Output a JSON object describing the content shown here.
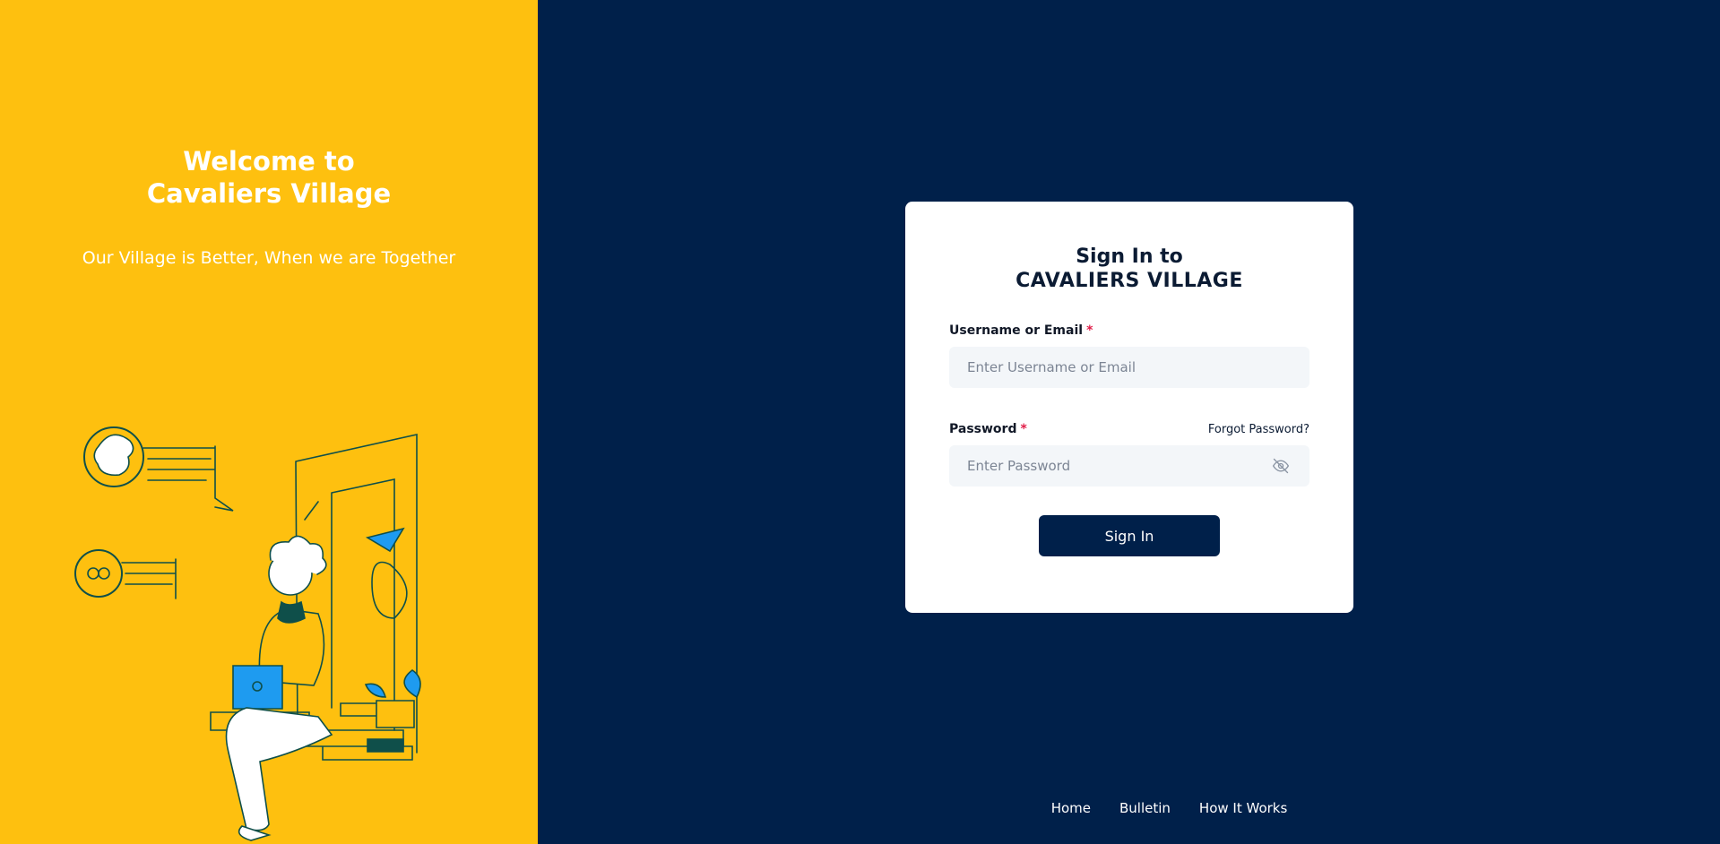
{
  "welcome": {
    "line1": "Welcome to",
    "line2": "Cavaliers Village",
    "tagline": "Our Village is Better, When we are Together"
  },
  "illustration": {
    "icon": "person-working-laptop-illustration"
  },
  "card": {
    "title_line1": "Sign In to",
    "title_line2": "CAVALIERS VILLAGE",
    "username_label": "Username or Email",
    "username_placeholder": "Enter Username or Email",
    "username_value": "",
    "password_label": "Password",
    "password_placeholder": "Enter Password",
    "password_value": "",
    "forgot_password": "Forgot Password?",
    "required_mark": "*",
    "submit_label": "Sign In"
  },
  "footer": {
    "links": [
      "Home",
      "Bulletin",
      "How It Works"
    ]
  },
  "colors": {
    "left_bg": "#FEC00F",
    "right_bg": "#00204A",
    "accent_blue": "#1E9BF0",
    "required": "#e11d48"
  }
}
